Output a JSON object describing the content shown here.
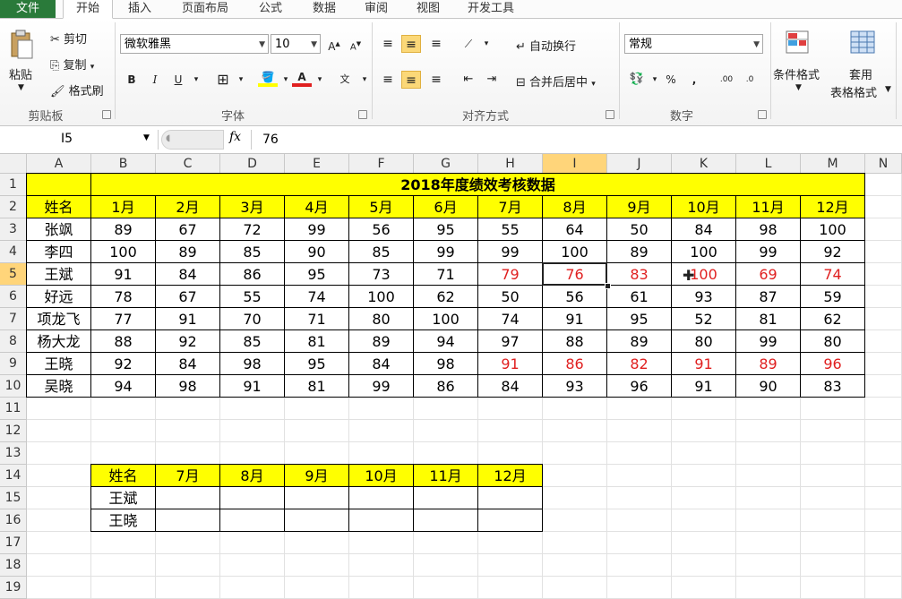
{
  "tabs": [
    "文件",
    "开始",
    "插入",
    "页面布局",
    "公式",
    "数据",
    "审阅",
    "视图",
    "开发工具"
  ],
  "clipboard": {
    "paste": "粘贴",
    "cut": "剪切",
    "copy": "复制",
    "format_painter": "格式刷",
    "group": "剪贴板"
  },
  "font": {
    "name": "微软雅黑",
    "size": "10",
    "group": "字体"
  },
  "alignment": {
    "wrap": "自动换行",
    "merge": "合并后居中",
    "group": "对齐方式"
  },
  "number": {
    "format": "常规",
    "group": "数字",
    "percent": "%",
    "comma": ","
  },
  "styles": {
    "conditional": "条件格式",
    "table_1": "套用",
    "table_2": "表格格式"
  },
  "formula_bar": {
    "name_box": "I5",
    "fx": "fx",
    "value": "76"
  },
  "columns": [
    "A",
    "B",
    "C",
    "D",
    "E",
    "F",
    "G",
    "H",
    "I",
    "J",
    "K",
    "L",
    "M",
    "N"
  ],
  "rows": [
    "1",
    "2",
    "3",
    "4",
    "5",
    "6",
    "7",
    "8",
    "9",
    "10",
    "11",
    "12",
    "13",
    "14",
    "15",
    "16",
    "17",
    "18",
    "19"
  ],
  "table_title": "2018年度绩效考核数据",
  "header_row": [
    "姓名",
    "1月",
    "2月",
    "3月",
    "4月",
    "5月",
    "6月",
    "7月",
    "8月",
    "9月",
    "10月",
    "11月",
    "12月"
  ],
  "data_rows": [
    {
      "name": "张飒",
      "values": [
        "89",
        "67",
        "72",
        "99",
        "56",
        "95",
        "55",
        "64",
        "50",
        "84",
        "98",
        "100"
      ]
    },
    {
      "name": "李四",
      "values": [
        "100",
        "89",
        "85",
        "90",
        "85",
        "99",
        "99",
        "100",
        "89",
        "100",
        "99",
        "92"
      ]
    },
    {
      "name": "王斌",
      "values": [
        "91",
        "84",
        "86",
        "95",
        "73",
        "71",
        "79",
        "76",
        "83",
        "100",
        "69",
        "74"
      ]
    },
    {
      "name": "好远",
      "values": [
        "78",
        "67",
        "55",
        "74",
        "100",
        "62",
        "50",
        "56",
        "61",
        "93",
        "87",
        "59"
      ]
    },
    {
      "name": "项龙飞",
      "values": [
        "77",
        "91",
        "70",
        "71",
        "80",
        "100",
        "74",
        "91",
        "95",
        "52",
        "81",
        "62"
      ]
    },
    {
      "name": "杨大龙",
      "values": [
        "88",
        "92",
        "85",
        "81",
        "89",
        "94",
        "97",
        "88",
        "89",
        "80",
        "99",
        "80"
      ]
    },
    {
      "name": "王晓",
      "values": [
        "92",
        "84",
        "98",
        "95",
        "84",
        "98",
        "91",
        "86",
        "82",
        "91",
        "89",
        "96"
      ]
    },
    {
      "name": "吴晓",
      "values": [
        "94",
        "98",
        "91",
        "81",
        "99",
        "86",
        "84",
        "93",
        "96",
        "91",
        "90",
        "83"
      ]
    }
  ],
  "summary_header": [
    "姓名",
    "7月",
    "8月",
    "9月",
    "10月",
    "11月",
    "12月"
  ],
  "summary_rows": [
    {
      "name": "王斌"
    },
    {
      "name": "王晓"
    }
  ],
  "colors": {
    "header_fill": "#ffff00",
    "highlight_text": "#e02020",
    "file_tab": "#2a7a3a",
    "selected_header": "#ffd57a"
  }
}
